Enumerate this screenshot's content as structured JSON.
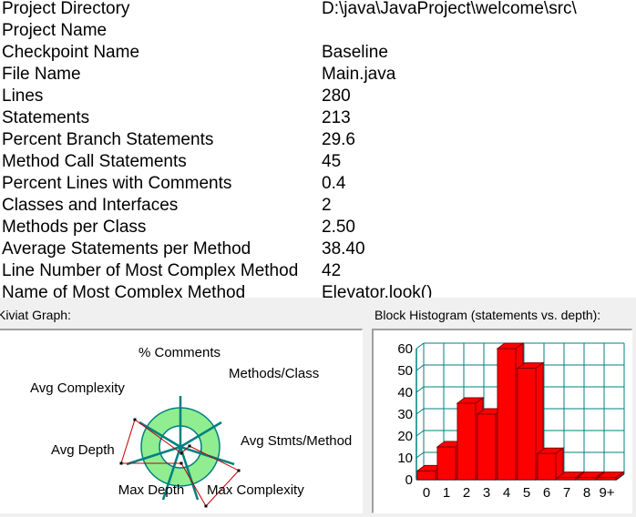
{
  "metrics": [
    {
      "label": "Project Directory",
      "value": "D:\\java\\JavaProject\\welcome\\src\\"
    },
    {
      "label": "Project Name",
      "value": ""
    },
    {
      "label": "Checkpoint Name",
      "value": "Baseline"
    },
    {
      "label": "File Name",
      "value": "Main.java"
    },
    {
      "label": "Lines",
      "value": "280"
    },
    {
      "label": "Statements",
      "value": "213"
    },
    {
      "label": "Percent Branch Statements",
      "value": "29.6"
    },
    {
      "label": "Method Call Statements",
      "value": "45"
    },
    {
      "label": "Percent Lines with Comments",
      "value": "0.4"
    },
    {
      "label": "Classes and Interfaces",
      "value": "2"
    },
    {
      "label": "Methods per Class",
      "value": "2.50"
    },
    {
      "label": "Average Statements per Method",
      "value": "38.40"
    },
    {
      "label": "Line Number of Most Complex Method",
      "value": "42"
    },
    {
      "label": "Name of Most Complex Method",
      "value": "Elevator.look()"
    }
  ],
  "kiviat": {
    "title": "Kiviat Graph:",
    "axes": [
      "% Comments",
      "Methods/Class",
      "Avg Stmts/Method",
      "Max Complexity",
      "Max Depth",
      "Avg Depth",
      "Avg Complexity"
    ],
    "colors": {
      "outer_ring": "#90ee90",
      "inner_ring": "#ffffff",
      "axes": "#008080",
      "polygon": "#c00000",
      "vertex": "#000000"
    }
  },
  "histogram": {
    "title": "Block Histogram (statements vs. depth):",
    "colors": {
      "bar": "#ff0000",
      "bar_edge": "#800000",
      "grid": "#008080"
    }
  },
  "chart_data": {
    "type": "bar",
    "title": "Block Histogram (statements vs. depth):",
    "categories": [
      "0",
      "1",
      "2",
      "3",
      "4",
      "5",
      "6",
      "7",
      "8",
      "9+"
    ],
    "values": [
      4,
      15,
      35,
      30,
      60,
      51,
      12,
      1,
      1,
      1
    ],
    "ylim": [
      0,
      60
    ],
    "yticks": [
      "0",
      "10",
      "20",
      "30",
      "40",
      "50",
      "60"
    ],
    "xlabel": "",
    "ylabel": "",
    "grid": true
  }
}
